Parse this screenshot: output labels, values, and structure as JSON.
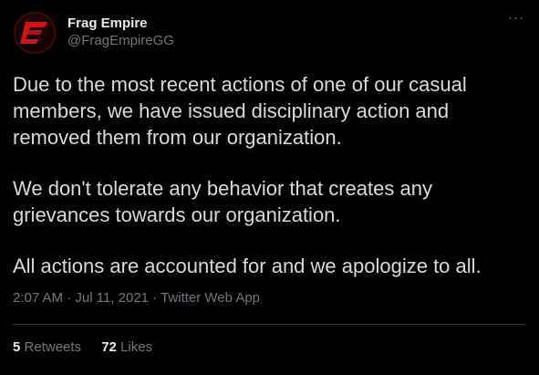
{
  "author": {
    "display_name": "Frag Empire",
    "handle": "@FragEmpireGG",
    "avatar_icon": "frag-empire-logo"
  },
  "more_icon": "more-horizontal-icon",
  "tweet": {
    "paragraphs": [
      "Due to the most recent actions of one of our casual members, we have issued disciplinary action and removed them from our organization.",
      "We don't tolerate any behavior that creates any grievances towards our organization.",
      "All actions are accounted for and we apologize to all."
    ],
    "time": "2:07 AM",
    "date": "Jul 11, 2021",
    "source": "Twitter Web App",
    "separator": " · "
  },
  "stats": {
    "retweets_count": "5",
    "retweets_label": "Retweets",
    "likes_count": "72",
    "likes_label": "Likes"
  },
  "colors": {
    "background": "#000000",
    "text": "#d9d9d9",
    "muted": "#6e767d",
    "brand_red": "#d4121b"
  }
}
